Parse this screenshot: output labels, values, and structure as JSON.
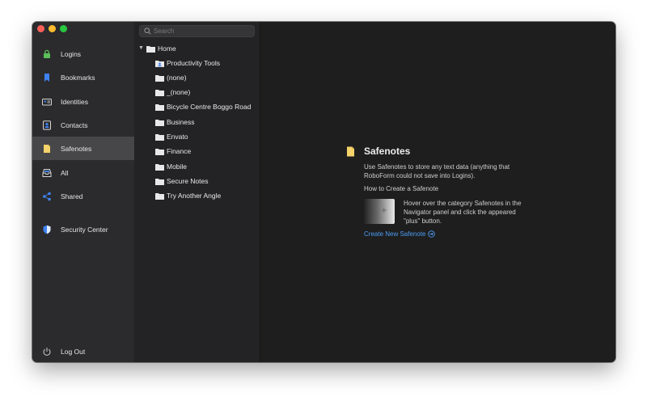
{
  "sidebar": {
    "items": [
      {
        "label": "Logins",
        "icon": "lock-icon"
      },
      {
        "label": "Bookmarks",
        "icon": "bookmark-icon"
      },
      {
        "label": "Identities",
        "icon": "id-card-icon"
      },
      {
        "label": "Contacts",
        "icon": "contact-icon"
      },
      {
        "label": "Safenotes",
        "icon": "note-icon",
        "active": true
      },
      {
        "label": "All",
        "icon": "inbox-icon"
      },
      {
        "label": "Shared",
        "icon": "share-icon"
      },
      {
        "label": "Security Center",
        "icon": "shield-icon"
      }
    ],
    "logout": {
      "label": "Log Out",
      "icon": "power-icon"
    }
  },
  "tree": {
    "search_placeholder": "Search",
    "root": "Home",
    "folders": [
      "Productivity Tools",
      "(none)",
      "_(none)",
      "Bicycle Centre Boggo Road",
      "Business",
      "Envato",
      "Finance",
      "Mobile",
      "Secure Notes",
      "Try Another Angle"
    ]
  },
  "content": {
    "title": "Safenotes",
    "description": "Use Safenotes to store any text data (anything that RoboForm could not save into Logins).",
    "how_to": "How to Create a Safenote",
    "hint": "Hover over the category Safenotes in the Navigator panel and click the appeared \"plus\" button.",
    "preview_symbol": "+",
    "create_link": "Create New Safenote"
  },
  "colors": {
    "sidebar_bg": "#2b2b2d",
    "active_item": "#474749",
    "tree_bg": "#232325",
    "content_bg": "#1e1e1e",
    "link": "#4a9cf2",
    "folder": "#e8e8e8",
    "note_yellow": "#f5d36b"
  }
}
